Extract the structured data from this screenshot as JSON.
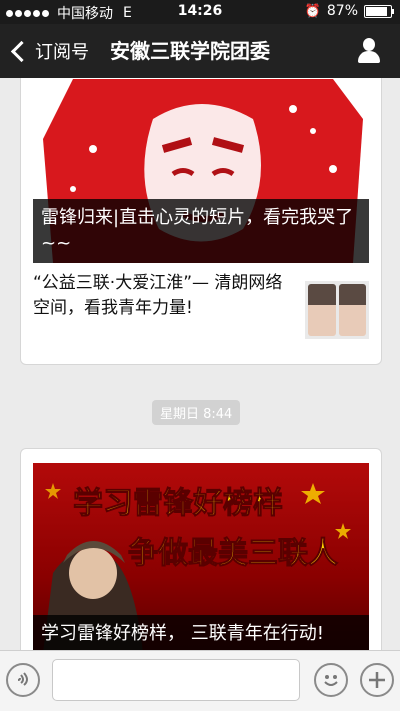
{
  "status_bar": {
    "carrier": "中国移动",
    "network": "E",
    "time": "14:26",
    "battery": "87%",
    "battery_level": 0.87
  },
  "nav": {
    "back_label": "订阅号",
    "title": "安徽三联学院团委"
  },
  "feed": {
    "card1": {
      "cover_caption": "雷锋归来|直击心灵的短片，看完我哭了~~",
      "item_text": "“公益三联·大爱江淮”— 清朗网络空间，看我青年力量!"
    },
    "timestamp": "星期日 8:44",
    "card2": {
      "banner_line1": "学习雷锋好榜样",
      "banner_line2": "争做最美三联人",
      "cover_caption": "学习雷锋好榜样， 三联青年在行动!"
    }
  },
  "colors": {
    "nav_bg": "#222222",
    "banner_red": "#b30a0a",
    "banner_yellow": "#ffd700"
  }
}
